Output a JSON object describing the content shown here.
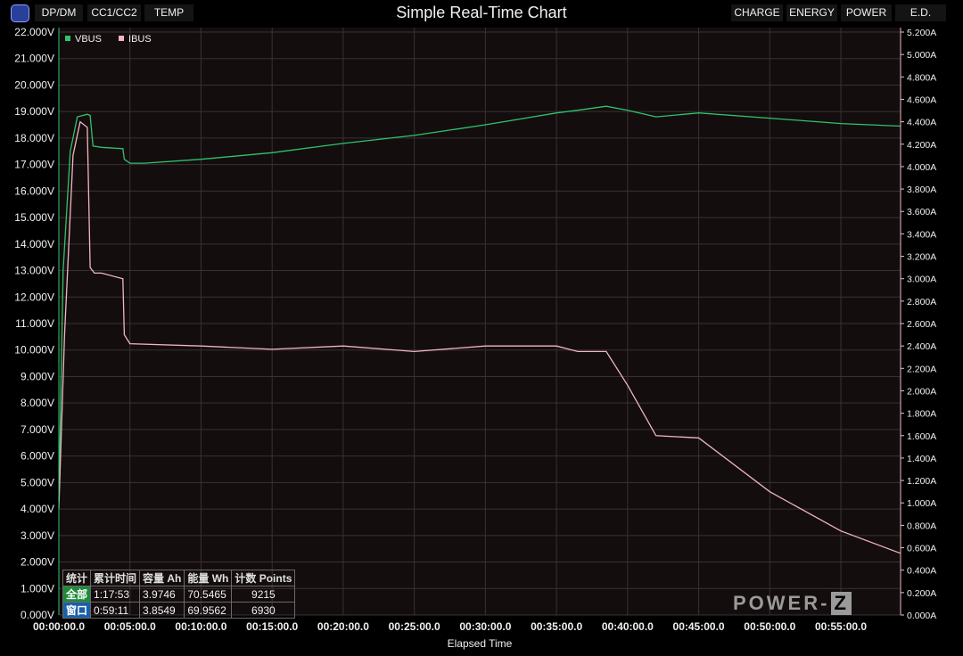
{
  "window": {
    "title": "Simple Real-Time Chart"
  },
  "toolbar_left": [
    {
      "label": "DP/DM"
    },
    {
      "label": "CC1/CC2"
    },
    {
      "label": "TEMP"
    }
  ],
  "toolbar_right": [
    {
      "label": "CHARGE"
    },
    {
      "label": "ENERGY"
    },
    {
      "label": "POWER"
    },
    {
      "label": "E.D."
    }
  ],
  "brand": {
    "text": "POWER-",
    "badge": "Z"
  },
  "stats": {
    "headers": [
      "统计",
      "累计时间",
      "容量 Ah",
      "能量 Wh",
      "计数 Points"
    ],
    "rows": [
      {
        "label": "全部",
        "time": "1:17:53",
        "ah": "3.9746",
        "wh": "70.5465",
        "points": "9215"
      },
      {
        "label": "窗口",
        "time": "0:59:11",
        "ah": "3.8549",
        "wh": "69.9562",
        "points": "6930"
      }
    ]
  },
  "colors": {
    "vbus": "#2ec46b",
    "ibus": "#f0b6c4",
    "plot_bg": "#140d0d",
    "grid": "#3a3232"
  },
  "chart_data": {
    "type": "line",
    "title": "Simple Real-Time Chart",
    "xlabel": "Elapsed Time",
    "x_unit": "minutes",
    "xlim": [
      0,
      59.2
    ],
    "x_ticks": [
      "00:00:00.0",
      "00:05:00.0",
      "00:10:00.0",
      "00:15:00.0",
      "00:20:00.0",
      "00:25:00.0",
      "00:30:00.0",
      "00:35:00.0",
      "00:40:00.0",
      "00:45:00.0",
      "00:50:00.0",
      "00:55:00.0"
    ],
    "y_left": {
      "ylim": [
        0,
        22
      ],
      "ticks": [
        "0.000V",
        "1.000V",
        "2.000V",
        "3.000V",
        "4.000V",
        "5.000V",
        "6.000V",
        "7.000V",
        "8.000V",
        "9.000V",
        "10.000V",
        "11.000V",
        "12.000V",
        "13.000V",
        "14.000V",
        "15.000V",
        "16.000V",
        "17.000V",
        "18.000V",
        "19.000V",
        "20.000V",
        "21.000V",
        "22.000V"
      ]
    },
    "y_right": {
      "ylim": [
        0,
        5.2
      ],
      "ticks": [
        "0.000A",
        "0.200A",
        "0.400A",
        "0.600A",
        "0.800A",
        "1.000A",
        "1.200A",
        "1.400A",
        "1.600A",
        "1.800A",
        "2.000A",
        "2.200A",
        "2.400A",
        "2.600A",
        "2.800A",
        "3.000A",
        "3.200A",
        "3.400A",
        "3.600A",
        "3.800A",
        "4.000A",
        "4.200A",
        "4.400A",
        "4.600A",
        "4.800A",
        "5.000A",
        "5.200A"
      ]
    },
    "grid": true,
    "legend_position": "top-left",
    "series": [
      {
        "name": "VBUS",
        "axis": "left",
        "x": [
          0,
          0.3,
          0.8,
          1.3,
          2.0,
          2.2,
          2.4,
          3.0,
          4.5,
          4.6,
          5.0,
          6.0,
          10,
          15,
          20,
          25,
          30,
          35,
          36.5,
          38.5,
          40,
          42,
          45,
          50,
          55,
          59.2
        ],
        "y": [
          4.3,
          13.0,
          17.5,
          18.8,
          18.9,
          18.85,
          17.7,
          17.65,
          17.6,
          17.2,
          17.05,
          17.05,
          17.2,
          17.45,
          17.8,
          18.1,
          18.5,
          18.95,
          19.05,
          19.2,
          19.05,
          18.8,
          18.95,
          18.75,
          18.55,
          18.45
        ]
      },
      {
        "name": "IBUS",
        "axis": "right",
        "x": [
          0,
          0.4,
          1.0,
          1.5,
          2.0,
          2.2,
          2.5,
          3.0,
          4.5,
          4.6,
          5.0,
          10,
          15,
          20,
          25,
          30,
          35,
          36.5,
          38.5,
          40,
          42,
          45,
          50,
          55,
          59.2
        ],
        "y": [
          0.95,
          2.5,
          4.1,
          4.4,
          4.35,
          3.1,
          3.05,
          3.05,
          3.0,
          2.5,
          2.42,
          2.4,
          2.37,
          2.4,
          2.35,
          2.4,
          2.4,
          2.35,
          2.35,
          2.05,
          1.6,
          1.58,
          1.1,
          0.75,
          0.55
        ]
      }
    ]
  }
}
